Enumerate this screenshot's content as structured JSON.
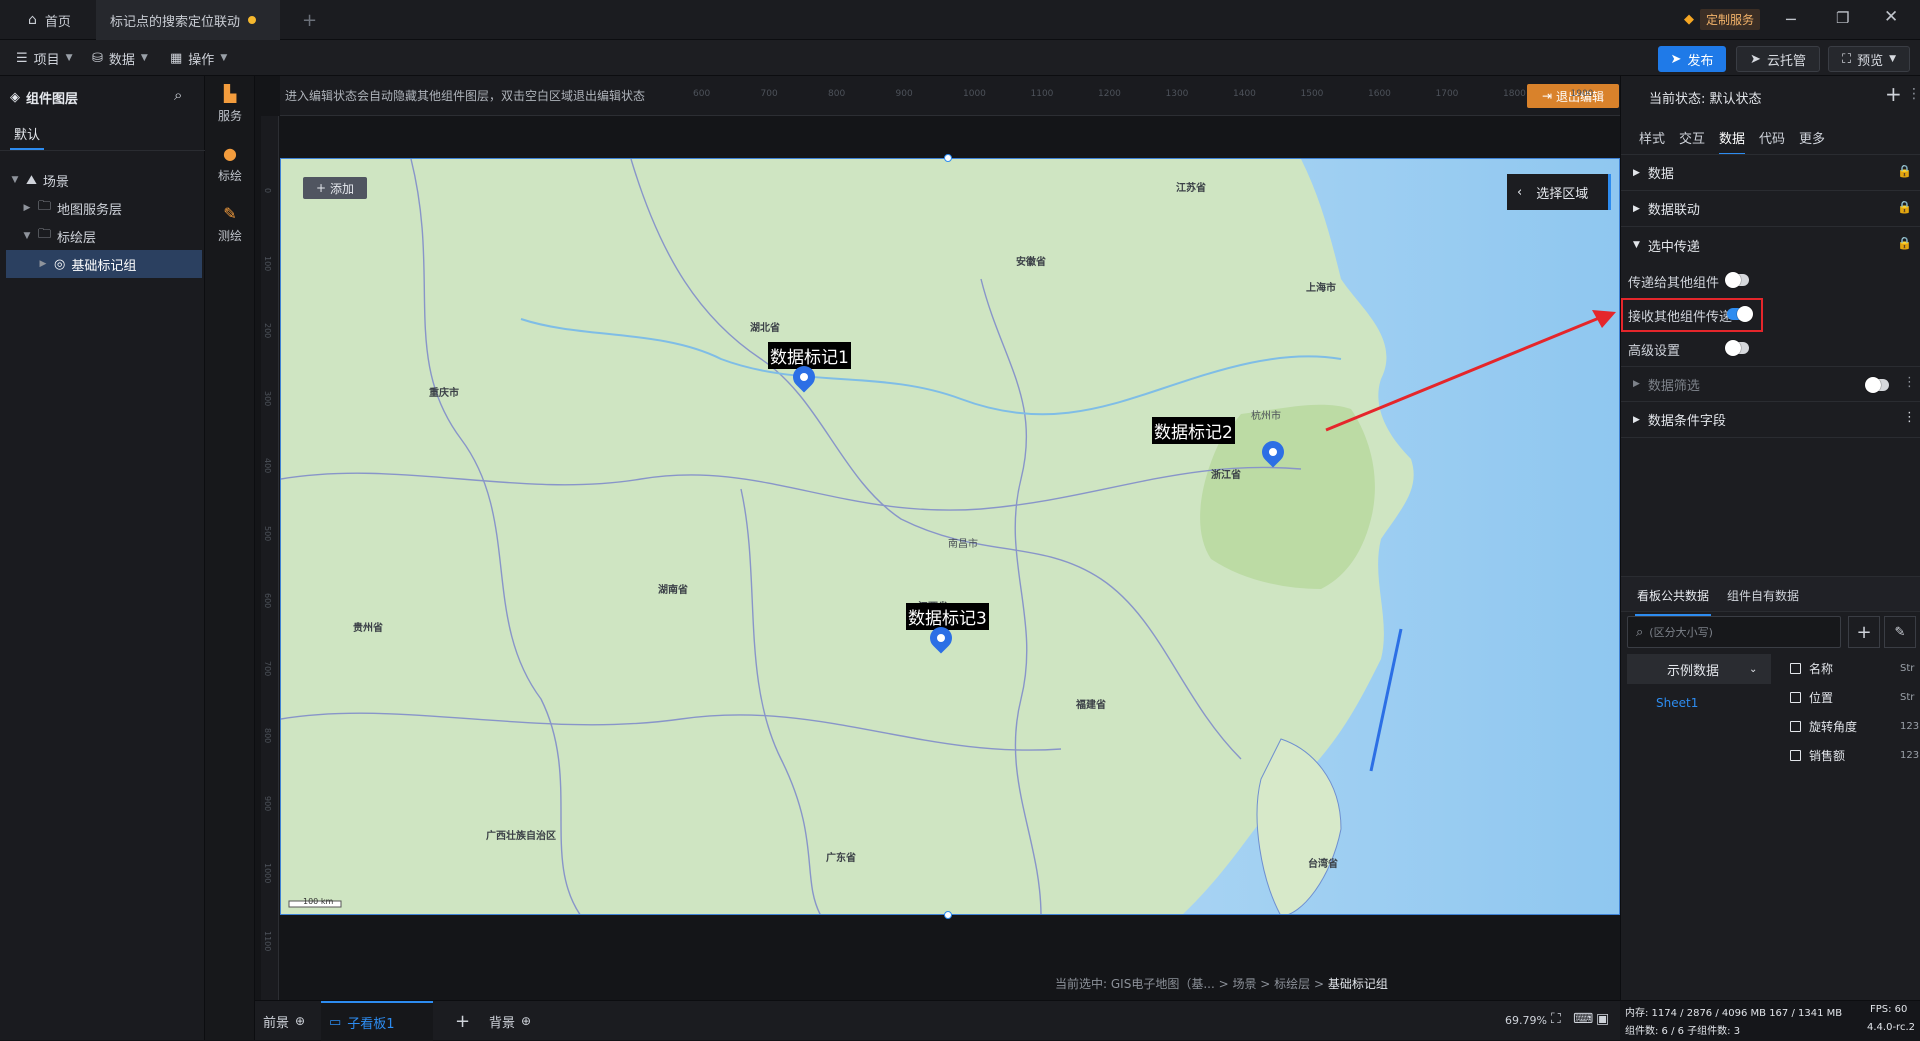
{
  "titlebar": {
    "home_tab": "首页",
    "doc_tab": "标记点的搜索定位联动",
    "add_tab": "+",
    "service_label": "定制服务"
  },
  "toolbar": {
    "project": "项目",
    "data": "数据",
    "operate": "操作",
    "publish": "发布",
    "cloud": "云托管",
    "preview": "预览"
  },
  "leftpanel": {
    "title": "组件图层",
    "default_tab": "默认",
    "tree": [
      "场景",
      "地图服务层",
      "标绘层",
      "基础标记组"
    ]
  },
  "iconbar": {
    "items": [
      "服务",
      "标绘",
      "测绘"
    ]
  },
  "canvas": {
    "hint": "进入编辑状态会自动隐藏其他组件图层，双击空白区域退出编辑状态",
    "exit_edit": "退出编辑",
    "add_btn": "添加",
    "select_area": "选择区域",
    "markers": [
      "数据标记1",
      "数据标记2",
      "数据标记3"
    ],
    "breadcrumb": "当前选中: GIS电子地图（基... > 场景 > 标绘层 >",
    "breadcrumb_current": "基础标记组",
    "scale": "100 km",
    "ruler_x": [
      "600",
      "700",
      "800",
      "900",
      "1000",
      "1100",
      "1200",
      "1300",
      "1400",
      "1500",
      "1600",
      "1700",
      "1800",
      "1900"
    ],
    "ruler_y": [
      "0",
      "100",
      "200",
      "300",
      "400",
      "500",
      "600",
      "700",
      "800",
      "900",
      "1000",
      "1100"
    ],
    "provinces": [
      "江苏省",
      "安徽省",
      "湖北省",
      "重庆市",
      "浙江省",
      "上海市",
      "江西省",
      "湖南省",
      "贵州省",
      "福建省",
      "广西壮族自治区",
      "台湾省",
      "广东省",
      "杭州市",
      "南昌市"
    ]
  },
  "rightpanel": {
    "state_label": "当前状态: 默认状态",
    "tabs": [
      "样式",
      "交互",
      "数据",
      "代码",
      "更多"
    ],
    "active_tab": "数据",
    "sections": [
      "数据",
      "数据联动",
      "选中传递"
    ],
    "pass_other": "传递给其他组件",
    "receive_other": "接收其他组件传递",
    "advanced": "高级设置",
    "data_filter": "数据筛选",
    "condition_fields": "数据条件字段",
    "public_tab": "看板公共数据",
    "own_tab": "组件自有数据",
    "search_placeholder": "(区分大小写)",
    "dataset": "示例数据",
    "sheet": "Sheet1",
    "fields": [
      {
        "name": "名称",
        "type": "Str"
      },
      {
        "name": "位置",
        "type": "Str"
      },
      {
        "name": "旋转角度",
        "type": "123"
      },
      {
        "name": "销售额",
        "type": "123"
      }
    ]
  },
  "bottombar": {
    "front": "前景",
    "sub": "子看板1",
    "back": "背景",
    "zoom": "69.79%",
    "memory": "内存: 1174 / 2876 / 4096 MB  167 / 1341 MB",
    "fps": "FPS: 60",
    "counts": "组件数: 6 / 6   子组件数: 3",
    "version": "4.4.0-rc.2"
  },
  "colors": {
    "accent": "#2d8cf0",
    "exit_btn": "#d9822b",
    "highlight": "#e5262b"
  }
}
